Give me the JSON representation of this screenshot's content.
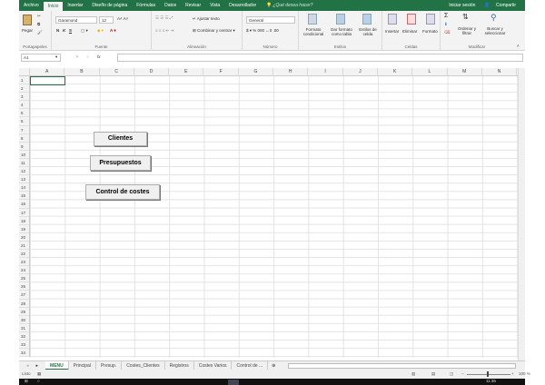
{
  "menu_tabs": [
    "Archivo",
    "Inicio",
    "Insertar",
    "Diseño de página",
    "Fórmulas",
    "Datos",
    "Revisar",
    "Vista",
    "Desarrollador"
  ],
  "tell_me": "¿Qué desea hacer?",
  "sign_in": "Iniciar sesión",
  "share": "Compartir",
  "ribbon": {
    "paste": "Pegar",
    "clipboard": "Portapapeles",
    "font_name": "Garamond",
    "font_size": "12",
    "bold": "N",
    "italic": "K",
    "underline": "S",
    "font_group": "Fuente",
    "wrap_text": "Ajustar texto",
    "merge_center": "Combinar y centrar",
    "alignment_group": "Alineación",
    "number_format": "General",
    "number_group": "Número",
    "cond_format": "Formato condicional",
    "format_table": "Dar formato como tabla",
    "cell_styles": "Estilos de celda",
    "styles_group": "Estilos",
    "insert": "Insertar",
    "delete": "Eliminar",
    "format": "Formato",
    "cells_group": "Celdas",
    "sort_filter": "Ordenar y filtrar",
    "find_select": "Buscar y seleccionar",
    "editing_group": "Modificar"
  },
  "formula_bar": {
    "name_box": "A1",
    "fx": "fx",
    "value": ""
  },
  "columns": [
    "A",
    "B",
    "C",
    "D",
    "E",
    "F",
    "G",
    "H",
    "I",
    "J",
    "K",
    "L",
    "M",
    "N"
  ],
  "rows": [
    "1",
    "2",
    "3",
    "4",
    "5",
    "6",
    "7",
    "8",
    "9",
    "10",
    "11",
    "12",
    "13",
    "14",
    "15",
    "16",
    "17",
    "18",
    "19",
    "20",
    "21",
    "22",
    "23",
    "24",
    "25",
    "26",
    "27",
    "28",
    "29",
    "30",
    "31",
    "32",
    "33",
    "34"
  ],
  "buttons": {
    "clientes": "Clientes",
    "presupuestos": "Presupuestos",
    "control": "Control de costes"
  },
  "sheets": [
    "MENU",
    "Principal",
    "Presup.",
    "Costes_Clientes",
    "Registros",
    "Costes Varios",
    "Control de ..."
  ],
  "status": {
    "ready": "Listo",
    "zoom": "100 %"
  },
  "taskbar": {
    "time": "11:36"
  }
}
